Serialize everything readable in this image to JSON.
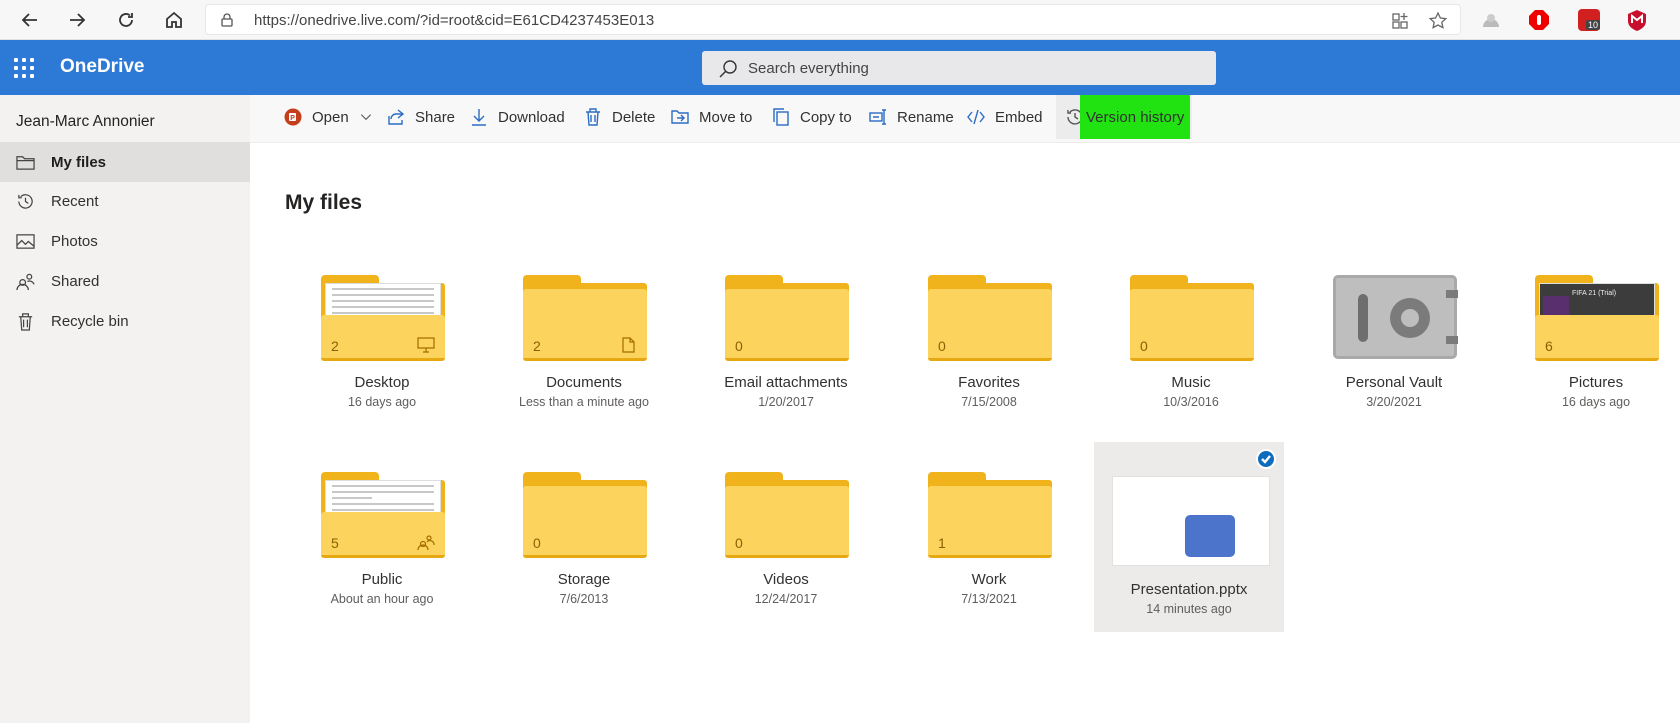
{
  "browser": {
    "url": "https://onedrive.live.com/?id=root&cid=E61CD4237453E013",
    "ext_badge": "10"
  },
  "header": {
    "brand": "OneDrive",
    "search_placeholder": "Search everything",
    "accent_color": "#2d7ad6"
  },
  "sidebar": {
    "user_name": "Jean-Marc Annonier",
    "items": [
      {
        "label": "My files",
        "icon": "folder-icon"
      },
      {
        "label": "Recent",
        "icon": "history-icon"
      },
      {
        "label": "Photos",
        "icon": "image-icon"
      },
      {
        "label": "Shared",
        "icon": "people-icon"
      },
      {
        "label": "Recycle bin",
        "icon": "trash-icon"
      }
    ]
  },
  "commands": {
    "open": "Open",
    "share": "Share",
    "download": "Download",
    "delete": "Delete",
    "move_to": "Move to",
    "copy_to": "Copy to",
    "rename": "Rename",
    "embed": "Embed",
    "version_history": "Version history",
    "highlight_color": "#22e312"
  },
  "main": {
    "title": "My files",
    "items": [
      {
        "name": "Desktop",
        "date": "16 days ago",
        "count": "2",
        "badge": "monitor-icon"
      },
      {
        "name": "Documents",
        "date": "Less than a minute ago",
        "count": "2",
        "badge": "document-icon"
      },
      {
        "name": "Email attachments",
        "date": "1/20/2017",
        "count": "0"
      },
      {
        "name": "Favorites",
        "date": "7/15/2008",
        "count": "0"
      },
      {
        "name": "Music",
        "date": "10/3/2016",
        "count": "0"
      },
      {
        "name": "Personal Vault",
        "date": "3/20/2021"
      },
      {
        "name": "Pictures",
        "date": "16 days ago",
        "count": "6",
        "thumb_text": "FIFA 21 (Trial)"
      },
      {
        "name": "Public",
        "date": "About an hour ago",
        "count": "5",
        "badge": "people-icon"
      },
      {
        "name": "Storage",
        "date": "7/6/2013",
        "count": "0"
      },
      {
        "name": "Videos",
        "date": "12/24/2017",
        "count": "0"
      },
      {
        "name": "Work",
        "date": "7/13/2021",
        "count": "1"
      },
      {
        "name": "Presentation.pptx",
        "date": "14 minutes ago",
        "selected": true
      }
    ]
  }
}
